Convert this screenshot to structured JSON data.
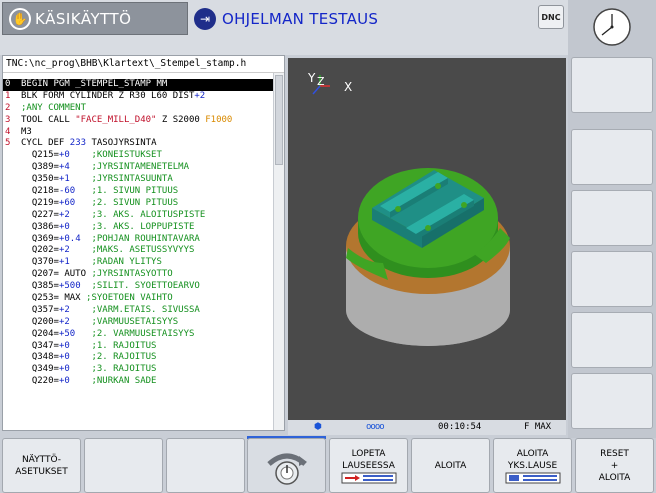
{
  "header": {
    "manual_mode": "KÄSIKÄYTTÖ",
    "test_mode": "OHJELMAN TESTAUS",
    "dnc_label": "DNC",
    "manual_icon": "hand-icon",
    "test_icon": "arrow-into-box-icon"
  },
  "program": {
    "path": "TNC:\\nc_prog\\BHB\\Klartext\\_Stempel_stamp.h",
    "lines": [
      {
        "nr": "0",
        "code": "BEGIN PGM _STEMPEL_STAMP MM"
      },
      {
        "nr": "1",
        "code": "BLK FORM CYLINDER Z R30 L60 DIST",
        "val": "+2"
      },
      {
        "nr": "2",
        "code": "",
        "comment": ";ANY COMMENT"
      },
      {
        "nr": "3",
        "code": "TOOL CALL ",
        "str": "\"FACE_MILL_D40\"",
        "code2": " Z S2000 ",
        "feed": "F1000"
      },
      {
        "nr": "4",
        "code": "M3"
      },
      {
        "nr": "5",
        "code": "CYCL DEF ",
        "val": "233",
        "code2": " TASOJYRSINTA"
      },
      {
        "nr": "",
        "code": "  Q215=",
        "val": "+0",
        "comment": "    ;KONEISTUKSET"
      },
      {
        "nr": "",
        "code": "  Q389=",
        "val": "+4",
        "comment": "    ;JYRSINTAMENETELMA"
      },
      {
        "nr": "",
        "code": "  Q350=",
        "val": "+1",
        "comment": "    ;JYRSINTASUUNTA"
      },
      {
        "nr": "",
        "code": "  Q218=",
        "val": "-60",
        "comment": "   ;1. SIVUN PITUUS"
      },
      {
        "nr": "",
        "code": "  Q219=",
        "val": "+60",
        "comment": "   ;2. SIVUN PITUUS"
      },
      {
        "nr": "",
        "code": "  Q227=",
        "val": "+2",
        "comment": "    ;3. AKS. ALOITUSPISTE"
      },
      {
        "nr": "",
        "code": "  Q386=",
        "val": "+0",
        "comment": "    ;3. AKS. LOPPUPISTE"
      },
      {
        "nr": "",
        "code": "  Q369=",
        "val": "+0.4",
        "comment": "  ;POHJAN ROUHINTAVARA"
      },
      {
        "nr": "",
        "code": "  Q202=",
        "val": "+2",
        "comment": "    ;MAKS. ASETUSSYVYYS"
      },
      {
        "nr": "",
        "code": "  Q370=",
        "val": "+1",
        "comment": "    ;RADAN YLITYS"
      },
      {
        "nr": "",
        "code": "  Q207= AUTO ",
        "comment": ";JYRSINTASYOTTO"
      },
      {
        "nr": "",
        "code": "  Q385=",
        "val": "+500",
        "comment": "  ;SILIT. SYOETTOEARVO"
      },
      {
        "nr": "",
        "code": "  Q253= MAX ",
        "comment": ";SYOETOEN VAIHTO"
      },
      {
        "nr": "",
        "code": "  Q357=",
        "val": "+2",
        "comment": "    ;VARM.ETAIS. SIVUSSA"
      },
      {
        "nr": "",
        "code": "  Q200=",
        "val": "+2",
        "comment": "    ;VARMUUSETAISYYS"
      },
      {
        "nr": "",
        "code": "  Q204=",
        "val": "+50",
        "comment": "   ;2. VARMUUSETAISYYS"
      },
      {
        "nr": "",
        "code": "  Q347=",
        "val": "+0",
        "comment": "    ;1. RAJOITUS"
      },
      {
        "nr": "",
        "code": "  Q348=",
        "val": "+0",
        "comment": "    ;2. RAJOITUS"
      },
      {
        "nr": "",
        "code": "  Q349=",
        "val": "+0",
        "comment": "    ;3. RAJOITUS"
      },
      {
        "nr": "",
        "code": "  Q220=",
        "val": "+0",
        "comment": "    ;NURKAN SADE"
      }
    ]
  },
  "view": {
    "axis_y": "Y",
    "axis_z": "Z",
    "axis_x": "X",
    "colors": {
      "green": "#3fa524",
      "teal": "#1f8f86",
      "brown": "#b3762f",
      "gray": "#a9a9a9"
    }
  },
  "status": {
    "time": "00:10:54",
    "feed": "F MAX",
    "dots": "oooo"
  },
  "softkeys": [
    {
      "line1": "NÄYTTÖ-",
      "line2": "ASETUKSET"
    },
    {
      "line1": "",
      "line2": ""
    },
    {
      "line1": "",
      "line2": ""
    },
    {
      "line1": "",
      "line2": ""
    },
    {
      "line1": "LOPETA",
      "line2": "LAUSEESSA"
    },
    {
      "line1": "ALOITA",
      "line2": ""
    },
    {
      "line1": "ALOITA",
      "line2": "YKS.LAUSE"
    },
    {
      "line1": "RESET",
      "line2": "+",
      "line3": "ALOITA"
    }
  ]
}
